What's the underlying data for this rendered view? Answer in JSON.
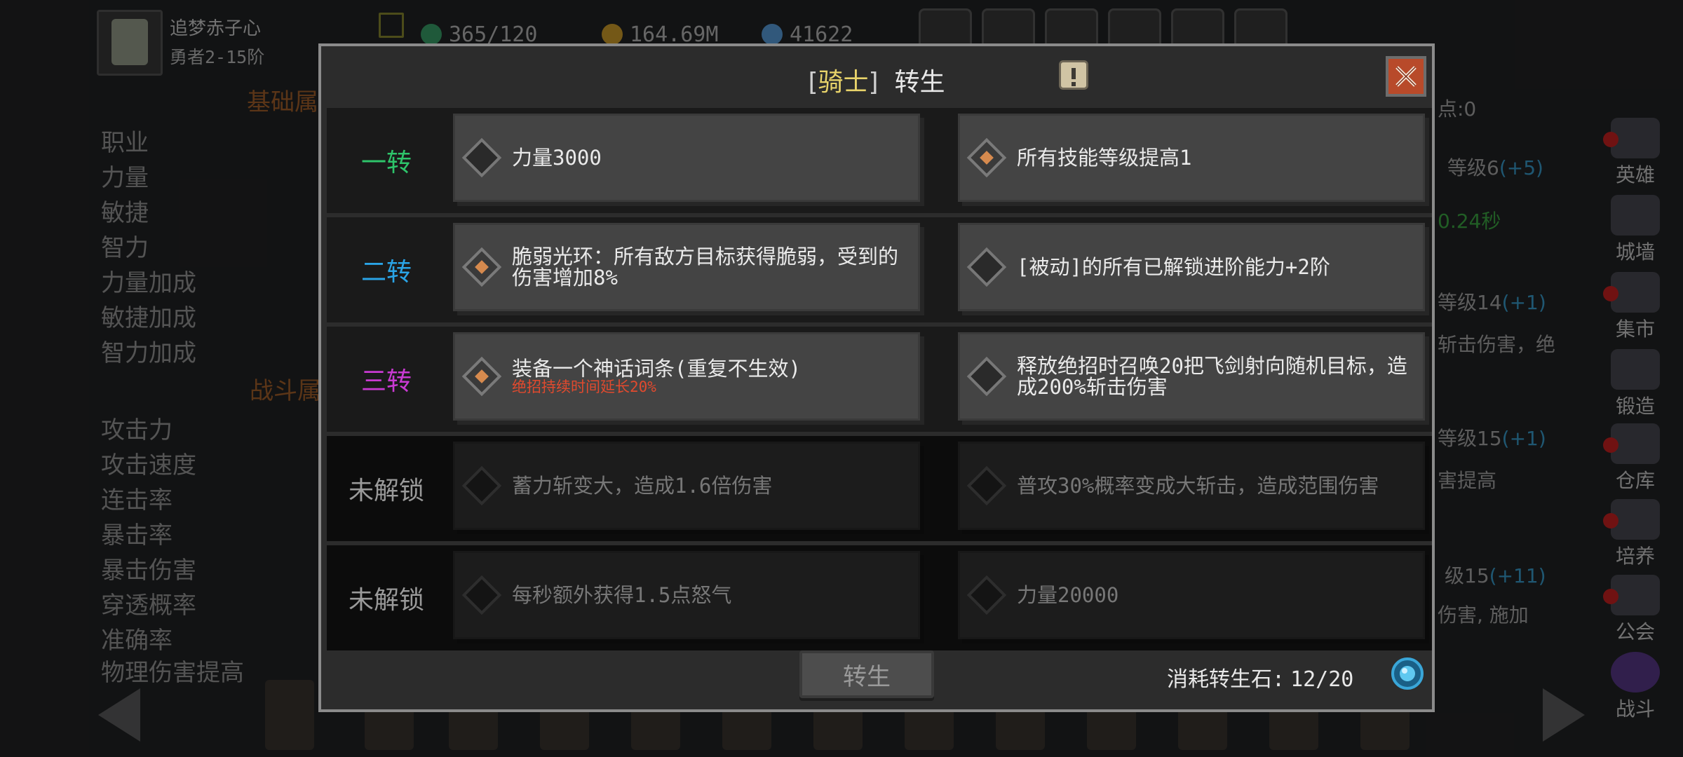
{
  "player": {
    "name": "追梦赤子心",
    "rank": "勇者2-15阶"
  },
  "resources": [
    {
      "icon": "energy-icon",
      "value": "365/120",
      "color": "#3aa36a"
    },
    {
      "icon": "gold-icon",
      "value": "164.69M",
      "color": "#d4a02a"
    },
    {
      "icon": "gem-icon",
      "value": "41622",
      "color": "#5aa0e0"
    }
  ],
  "background": {
    "sections": [
      "基础属",
      "战斗属"
    ],
    "basic_stats": [
      "职业",
      "力量",
      "敏捷",
      "智力",
      "力量加成",
      "敏捷加成",
      "智力加成"
    ],
    "combat_stats": [
      "攻击力",
      "攻击速度",
      "连击率",
      "暴击率",
      "暴击伤害",
      "穿透概率",
      "准确率",
      "物理伤害提高"
    ],
    "right_points": "点:0",
    "right_lines": [
      {
        "a": "等级6",
        "b": "(+5)"
      },
      {
        "a": "0.24秒",
        "b": ""
      },
      {
        "a": "等级14",
        "b": "(+1)"
      },
      {
        "a": "斩击伤害，绝",
        "b": ""
      },
      {
        "a": "等级15",
        "b": "(+1)"
      },
      {
        "a": "害提高",
        "b": ""
      },
      {
        "a": "级15",
        "b": "(+11)"
      },
      {
        "a": "伤害, 施加",
        "b": ""
      }
    ]
  },
  "sidebar": [
    {
      "label": "英雄",
      "icon": "hero-icon",
      "alert": true
    },
    {
      "label": "城墙",
      "icon": "wall-icon",
      "alert": false
    },
    {
      "label": "集市",
      "icon": "market-icon",
      "alert": true
    },
    {
      "label": "锻造",
      "icon": "forge-icon",
      "alert": false
    },
    {
      "label": "仓库",
      "icon": "warehouse-icon",
      "alert": true
    },
    {
      "label": "培养",
      "icon": "train-icon",
      "alert": true
    },
    {
      "label": "公会",
      "icon": "guild-icon",
      "alert": true
    },
    {
      "label": "战斗",
      "icon": "battle-icon",
      "alert": false
    }
  ],
  "modal": {
    "class_name": "骑士",
    "bracket_open": "[",
    "bracket_close": "]",
    "title": "转生",
    "rows": [
      {
        "tier": "一转",
        "tier_color": "#2ec46a",
        "locked": false,
        "cells": [
          {
            "text": "力量3000",
            "sub": "",
            "active": false
          },
          {
            "text": "所有技能等级提高1",
            "sub": "",
            "active": true
          }
        ]
      },
      {
        "tier": "二转",
        "tier_color": "#2aa4e6",
        "locked": false,
        "cells": [
          {
            "text": "脆弱光环：所有敌方目标获得脆弱，受到的伤害增加8%",
            "sub": "",
            "active": true
          },
          {
            "text": "[被动]的所有已解锁进阶能力+2阶",
            "sub": "",
            "active": false
          }
        ]
      },
      {
        "tier": "三转",
        "tier_color": "#c93ad2",
        "locked": false,
        "cells": [
          {
            "text": "装备一个神话词条(重复不生效)",
            "sub": "绝招持续时间延长20%",
            "active": true
          },
          {
            "text": "释放绝招时召唤20把飞剑射向随机目标，造成200%斩击伤害",
            "sub": "",
            "active": false
          }
        ]
      },
      {
        "tier": "未解锁",
        "tier_color": "#9a9a9a",
        "locked": true,
        "cells": [
          {
            "text": "蓄力斩变大，造成1.6倍伤害",
            "sub": "",
            "active": false
          },
          {
            "text": "普攻30%概率变成大斩击，造成范围伤害",
            "sub": "",
            "active": false
          }
        ]
      },
      {
        "tier": "未解锁",
        "tier_color": "#9a9a9a",
        "locked": true,
        "cells": [
          {
            "text": "每秒额外获得1.5点怒气",
            "sub": "",
            "active": false
          },
          {
            "text": "力量20000",
            "sub": "",
            "active": false
          }
        ]
      }
    ],
    "rebirth_button": "转生",
    "cost_label": "消耗转生石:",
    "cost_value": "12/20"
  }
}
